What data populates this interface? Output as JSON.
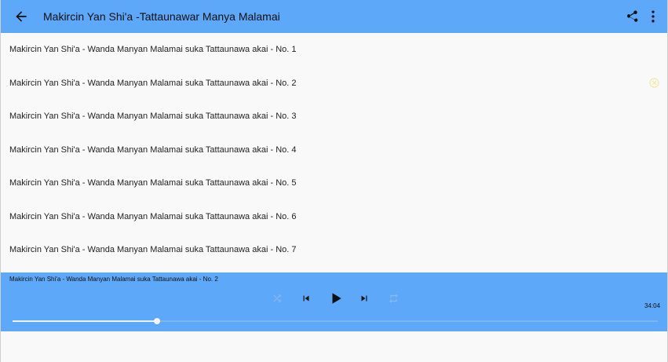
{
  "app": {
    "title": "Makircin Yan Shi'a -Tattaunawar Manya Malamai",
    "icons": {
      "back": "arrow-left-icon",
      "share": "share-icon",
      "more": "more-vert-icon"
    }
  },
  "tracks": [
    {
      "label": "Makircin Yan Shi'a - Wanda Manyan Malamai suka Tattaunawa akai - No. 1"
    },
    {
      "label": "Makircin Yan Shi'a - Wanda Manyan Malamai suka Tattaunawa akai - No. 2",
      "playing": true
    },
    {
      "label": "Makircin Yan Shi'a - Wanda Manyan Malamai suka Tattaunawa akai - No. 3"
    },
    {
      "label": "Makircin Yan Shi'a - Wanda Manyan Malamai suka Tattaunawa akai - No. 4"
    },
    {
      "label": "Makircin Yan Shi'a - Wanda Manyan Malamai suka Tattaunawa akai - No. 5"
    },
    {
      "label": "Makircin Yan Shi'a - Wanda Manyan Malamai suka Tattaunawa akai - No. 6"
    },
    {
      "label": "Makircin Yan Shi'a - Wanda Manyan Malamai suka Tattaunawa akai - No. 7"
    }
  ],
  "player": {
    "now_playing": "Makircin Yan Shi'a - Wanda Manyan Malamai suka Tattaunawa akai - No. 2",
    "duration": "34:04",
    "progress": 0.224,
    "icons": [
      "shuffle-icon",
      "skip-previous-icon",
      "play-icon",
      "skip-next-icon",
      "repeat-icon"
    ]
  },
  "colors": {
    "accent": "#5ea8fa",
    "playing_badge": "#f5e79a",
    "background": "#f9f9f9"
  }
}
